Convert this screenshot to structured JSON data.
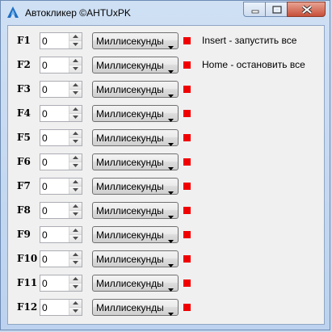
{
  "window": {
    "title": "Автокликер ©AHTUxPK",
    "app_icon": "app-logo-icon",
    "controls": [
      "minimize-icon",
      "maximize-icon",
      "close-icon"
    ]
  },
  "rows": [
    {
      "key": "F1",
      "value": "0",
      "unit": "Миллисекунды"
    },
    {
      "key": "F2",
      "value": "0",
      "unit": "Миллисекунды"
    },
    {
      "key": "F3",
      "value": "0",
      "unit": "Миллисекунды"
    },
    {
      "key": "F4",
      "value": "0",
      "unit": "Миллисекунды"
    },
    {
      "key": "F5",
      "value": "0",
      "unit": "Миллисекунды"
    },
    {
      "key": "F6",
      "value": "0",
      "unit": "Миллисекунды"
    },
    {
      "key": "F7",
      "value": "0",
      "unit": "Миллисекунды"
    },
    {
      "key": "F8",
      "value": "0",
      "unit": "Миллисекунды"
    },
    {
      "key": "F9",
      "value": "0",
      "unit": "Миллисекунды"
    },
    {
      "key": "F10",
      "value": "0",
      "unit": "Миллисекунды"
    },
    {
      "key": "F11",
      "value": "0",
      "unit": "Миллисекунды"
    },
    {
      "key": "F12",
      "value": "0",
      "unit": "Миллисекунды"
    }
  ],
  "status_color": "#f00000",
  "hints": {
    "start": "Insert - запустить все",
    "stop": "Home - остановить все"
  }
}
